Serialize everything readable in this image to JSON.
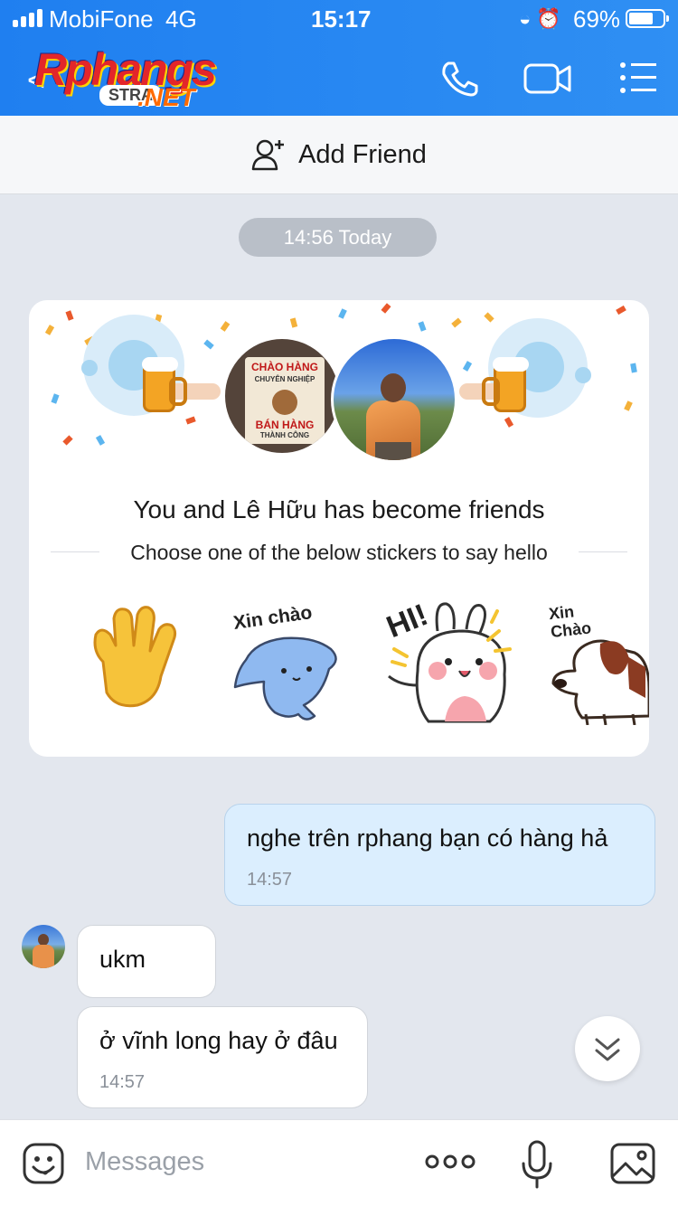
{
  "status_bar": {
    "carrier": "MobiFone",
    "network": "4G",
    "time": "15:17",
    "battery": "69%",
    "battery_level": 0.69
  },
  "header": {
    "back": "<",
    "logo_main": "Rphangs",
    "logo_strap": "STRA",
    "logo_net": ".NET"
  },
  "add_friend": {
    "label": "Add Friend"
  },
  "chat": {
    "date_pill": "14:56 Today",
    "friend_card": {
      "title": "You and Lê Hữu has become friends",
      "subtitle": "Choose one of the below stickers to say hello",
      "avatar_sign_top": "CHÀO HÀNG",
      "avatar_sign_mid": "CHUYÊN NGHIỆP",
      "avatar_sign_bottom": "BÁN HÀNG",
      "avatar_sign_last": "THÀNH CÔNG",
      "stickers": [
        {
          "name": "waving-hand"
        },
        {
          "name": "xin-chao-blob",
          "text": "Xin chào"
        },
        {
          "name": "hi-bunny",
          "text": "HI!"
        },
        {
          "name": "xin-chao-dog",
          "text": "Xin Chào"
        }
      ]
    },
    "messages": [
      {
        "from": "me",
        "text": "nghe trên rphang bạn có hàng hả",
        "time": "14:57"
      },
      {
        "from": "them",
        "text": "ukm",
        "time": ""
      },
      {
        "from": "them",
        "text": "ở vĩnh long hay ở đâu",
        "time": "14:57"
      }
    ]
  },
  "composer": {
    "placeholder": "Messages"
  },
  "colors": {
    "header": "#2589f2",
    "my_bubble": "#dbeefe",
    "background": "#e3e7ee"
  }
}
